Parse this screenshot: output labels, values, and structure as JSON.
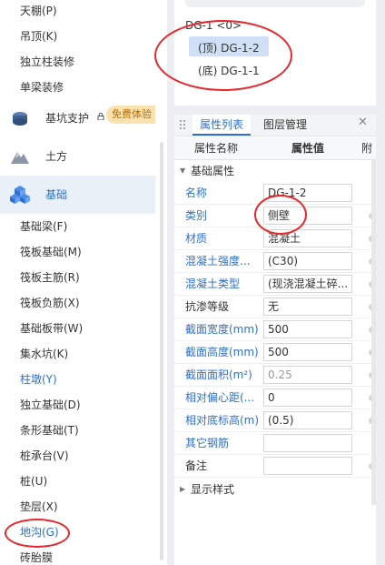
{
  "sidebar": {
    "top_items": [
      "天棚(P)",
      "吊顶(K)",
      "独立柱装修",
      "单梁装修"
    ],
    "categories": [
      {
        "label": "基坑支护",
        "badge": "免费体验"
      },
      {
        "label": "土方"
      },
      {
        "label": "基础"
      }
    ],
    "items": [
      "基础梁(F)",
      "筏板基础(M)",
      "筏板主筋(R)",
      "筏板负筋(X)",
      "基础板带(W)",
      "集水坑(K)",
      "柱墩(Y)",
      "独立基础(D)",
      "条形基础(T)",
      "桩承台(V)",
      "桩(U)",
      "垫层(X)",
      "地沟(G)",
      "砖胎膜"
    ]
  },
  "tree": {
    "root": "DG-1 <0>",
    "children": [
      "(顶) DG-1-2",
      "(底) DG-1-1"
    ]
  },
  "props": {
    "tabs": [
      "属性列表",
      "图层管理"
    ],
    "columns": [
      "属性名称",
      "属性值",
      "附"
    ],
    "group1": "基础属性",
    "rows": [
      {
        "name": "名称",
        "value": "DG-1-2"
      },
      {
        "name": "类别",
        "value": "侧壁"
      },
      {
        "name": "材质",
        "value": "混凝土"
      },
      {
        "name": "混凝土强度...",
        "value": "(C30)"
      },
      {
        "name": "混凝土类型",
        "value": "(现浇混凝土碎..."
      },
      {
        "name": "抗渗等级",
        "value": "无"
      },
      {
        "name": "截面宽度(mm)",
        "value": "500"
      },
      {
        "name": "截面高度(mm)",
        "value": "500"
      },
      {
        "name": "截面面积(m²)",
        "value": "0.25"
      },
      {
        "name": "相对偏心距(...",
        "value": "0"
      },
      {
        "name": "相对底标高(m)",
        "value": "(0.5)"
      },
      {
        "name": "其它钢筋",
        "value": ""
      },
      {
        "name": "备注",
        "value": ""
      }
    ],
    "group2": "显示样式"
  },
  "colors": {
    "accent": "#2f6fd1",
    "annotation": "#e8262b",
    "badge_bg": "#fbe3b0"
  }
}
